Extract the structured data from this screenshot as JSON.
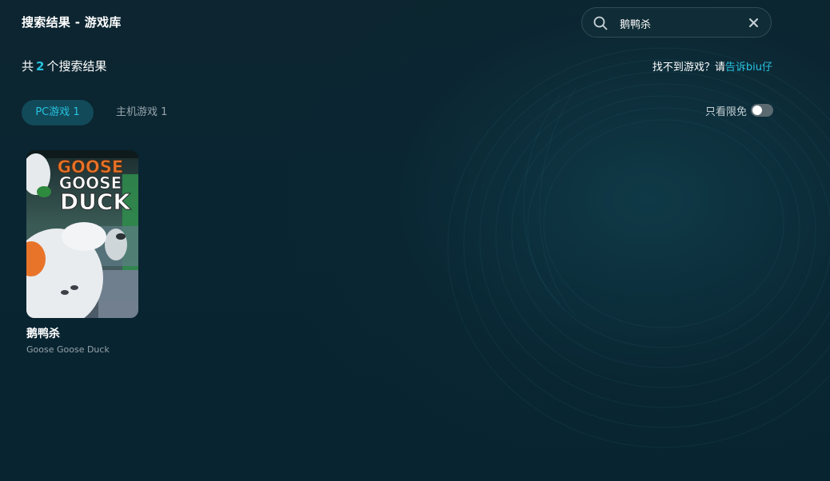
{
  "header": {
    "title": "搜索结果 - 游戏库"
  },
  "search": {
    "value": "鹅鸭杀",
    "icon": "search-icon",
    "clear_icon": "close-icon"
  },
  "summary": {
    "prefix": "共",
    "count": "2",
    "suffix": "个搜索结果"
  },
  "feedback": {
    "text": "找不到游戏？请",
    "link": "告诉biu仔"
  },
  "tabs": [
    {
      "label": "PC游戏 1",
      "active": true
    },
    {
      "label": "主机游戏 1",
      "active": false
    }
  ],
  "filter": {
    "label": "只看限免",
    "enabled": false
  },
  "games": [
    {
      "cover_title": [
        "GOOSE",
        "GOOSE",
        "DUCK"
      ],
      "name": "鹅鸭杀",
      "name_en": "Goose Goose Duck"
    }
  ],
  "colors": {
    "accent": "#27c2e0",
    "background": "#0a2532",
    "tab_active_bg": "#124a59",
    "cover_orange": "#e8742a"
  }
}
